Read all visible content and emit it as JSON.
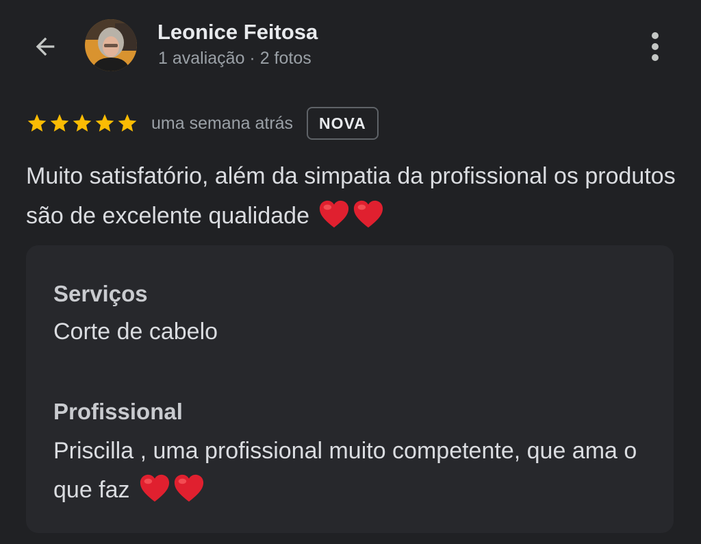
{
  "header": {
    "back_icon": "arrow-left-icon",
    "reviewer_name": "Leonice Feitosa",
    "reviewer_stats": "1 avaliação · 2 fotos",
    "more_icon": "more-vertical-icon"
  },
  "review": {
    "rating": 5,
    "rating_max": 5,
    "time_ago": "uma semana atrás",
    "badge": "NOVA",
    "text": "Muito satisfatório, além da simpatia da profissional os produtos são de excelente qualidade",
    "text_emoji": "❤️❤️"
  },
  "details": {
    "services_title": "Serviços",
    "services_value": "Corte de cabelo",
    "professional_title": "Profissional",
    "professional_value": "Priscilla , uma profissional muito competente, que ama o que faz",
    "professional_emoji": "❤️❤️"
  },
  "colors": {
    "background": "#202124",
    "card": "#27282c",
    "star": "#fbbc04",
    "heart": "#e0202f"
  }
}
